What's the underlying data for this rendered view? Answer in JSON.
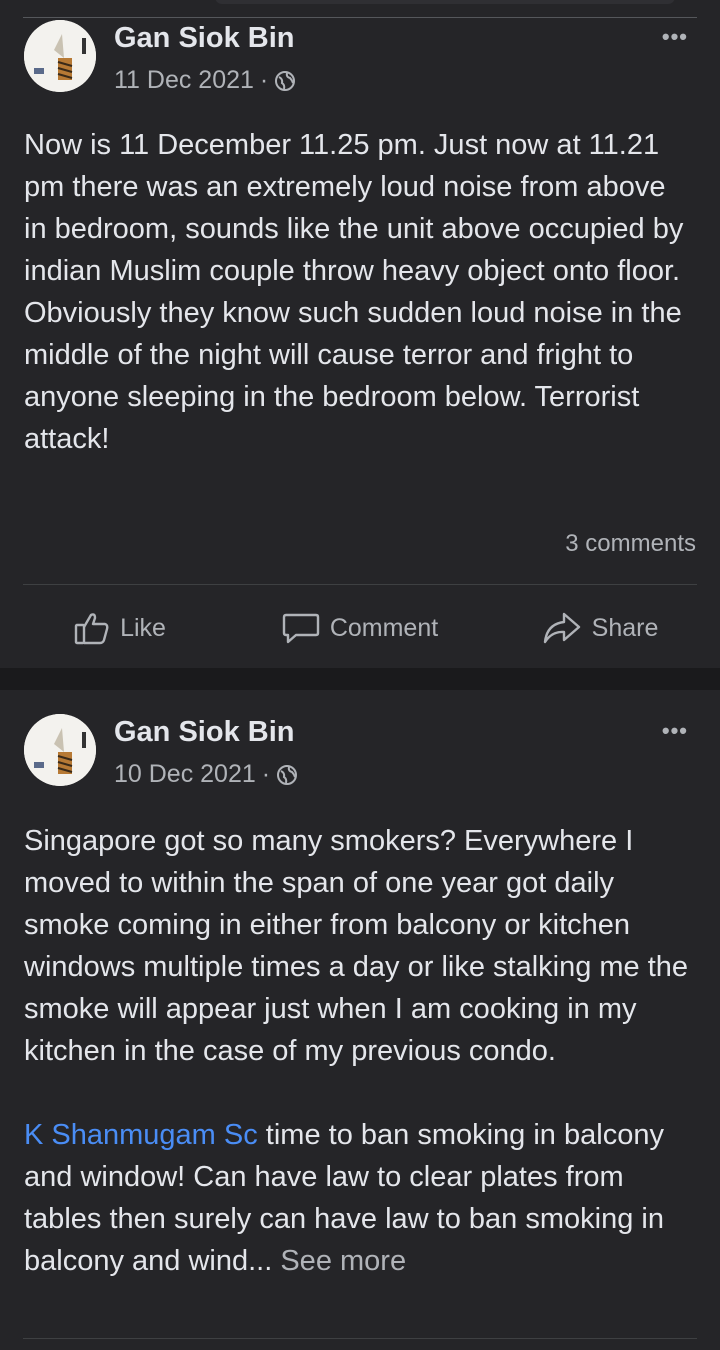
{
  "posts": [
    {
      "author": "Gan Siok Bin",
      "date": "11 Dec 2021",
      "more_label": "•••",
      "text": "Now is 11 December 11.25 pm. Just now at 11.21 pm there was an extremely loud noise from above in bedroom, sounds like the unit above occupied by indian Muslim couple throw heavy object onto floor. Obviously they know such sudden loud noise in the middle of the night will cause terror and fright to anyone sleeping in the bedroom below. Terrorist attack!",
      "comments": "3 comments",
      "actions": {
        "like": "Like",
        "comment": "Comment",
        "share": "Share"
      }
    },
    {
      "author": "Gan Siok Bin",
      "date": "10 Dec 2021",
      "more_label": "•••",
      "text": "Singapore got so many smokers? Everywhere I moved to within the span of one year got daily smoke coming in either from balcony or kitchen windows multiple times a day or like stalking me the smoke will appear just when I am cooking in my kitchen in the case of my previous condo.",
      "mention": "K Shanmugam Sc",
      "text2": " time to ban smoking in balcony and window! Can have law to clear plates from tables then surely can have law to ban smoking in balcony and wind...",
      "see_more": "See more"
    }
  ],
  "meta_separator": "·",
  "icons": {
    "privacy": "globe-icon",
    "like": "thumbs-up-icon",
    "comment": "comment-icon",
    "share": "share-icon",
    "more": "more-icon"
  }
}
